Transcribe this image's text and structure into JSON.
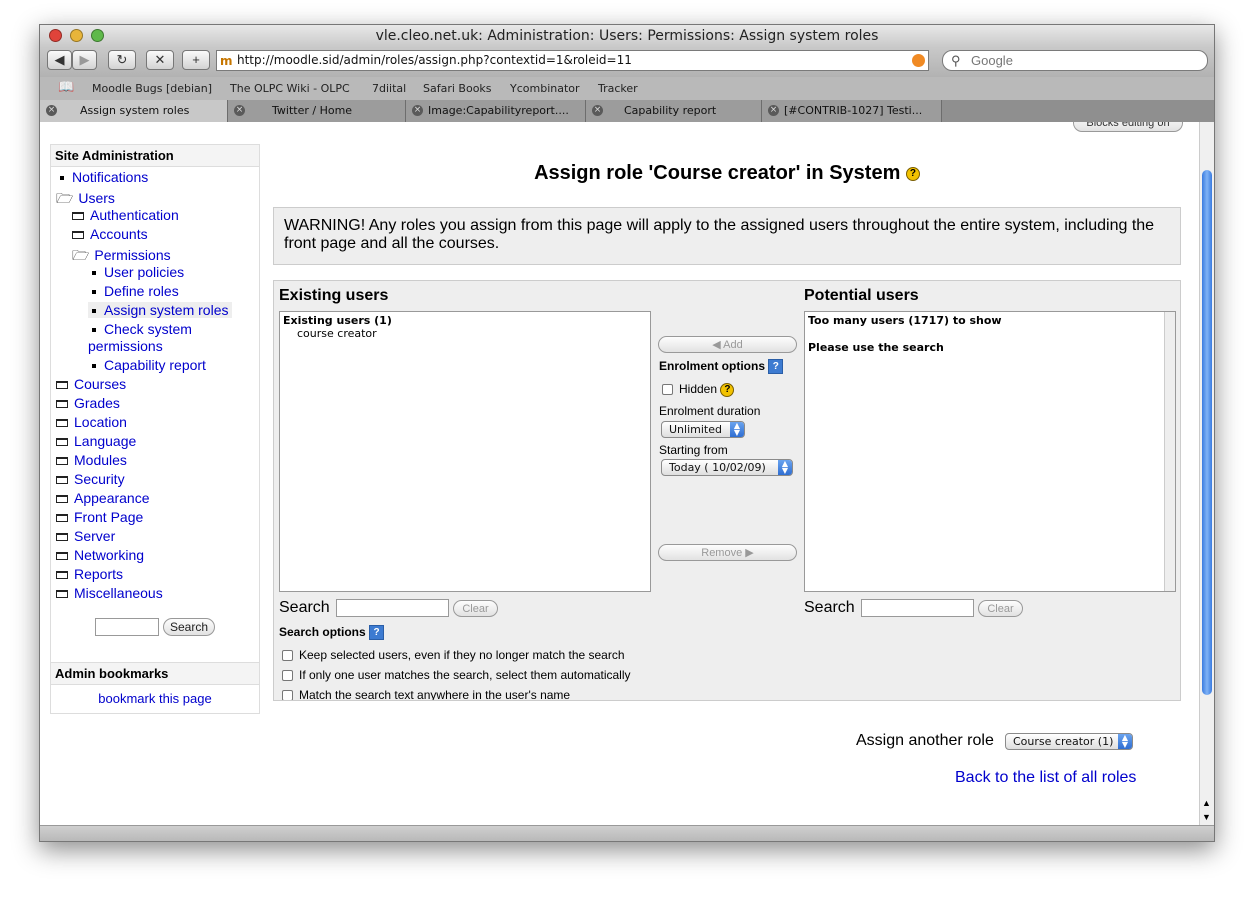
{
  "window": {
    "title": "vle.cleo.net.uk: Administration: Users: Permissions: Assign system roles",
    "url": "http://moodle.sid/admin/roles/assign.php?contextid=1&roleid=11",
    "search_placeholder": "Google"
  },
  "bookmarks": [
    "Moodle Bugs [debian]",
    "The OLPC Wiki - OLPC",
    "7diital",
    "Safari Books",
    "Ycombinator",
    "Tracker"
  ],
  "tabs": [
    {
      "label": "Assign system roles"
    },
    {
      "label": "Twitter / Home"
    },
    {
      "label": "Image:Capabilityreport...."
    },
    {
      "label": "Capability report"
    },
    {
      "label": "[#CONTRIB-1027] Testi..."
    }
  ],
  "top_partial_button": "Blocks editing on",
  "sidebar": {
    "title": "Site Administration",
    "items": {
      "notifications": "Notifications",
      "users": "Users",
      "authentication": "Authentication",
      "accounts": "Accounts",
      "permissions": "Permissions",
      "user_policies": "User policies",
      "define_roles": "Define roles",
      "assign_system_roles": "Assign system roles",
      "check_system_permissions_1": "Check system",
      "check_system_permissions_2": "permissions",
      "capability_report": "Capability report",
      "courses": "Courses",
      "grades": "Grades",
      "location": "Location",
      "language": "Language",
      "modules": "Modules",
      "security": "Security",
      "appearance": "Appearance",
      "front_page": "Front Page",
      "server": "Server",
      "networking": "Networking",
      "reports": "Reports",
      "miscellaneous": "Miscellaneous"
    },
    "search_button": "Search"
  },
  "admin_bookmarks": {
    "title": "Admin bookmarks",
    "link": "bookmark this page"
  },
  "main": {
    "heading": "Assign role 'Course creator' in System",
    "warning": "WARNING! Any roles you assign from this page will apply to the assigned users throughout the entire system, including the front page and all the courses.",
    "existing": {
      "title": "Existing users",
      "group": "Existing users (1)",
      "users": [
        "course creator"
      ],
      "search_label": "Search",
      "clear": "Clear"
    },
    "potential": {
      "title": "Potential users",
      "line1": "Too many users (1717) to show",
      "line2": "Please use the search",
      "search_label": "Search",
      "clear": "Clear"
    },
    "controls": {
      "add": "Add",
      "remove": "Remove",
      "enrolment_options": "Enrolment options",
      "hidden": "Hidden",
      "enrolment_duration": "Enrolment duration",
      "duration_value": "Unlimited",
      "starting_from": "Starting from",
      "starting_value": "Today ( 10/02/09)"
    },
    "search_options": {
      "title": "Search options",
      "opt1": "Keep selected users, even if they no longer match the search",
      "opt2": "If only one user matches the search, select them automatically",
      "opt3": "Match the search text anywhere in the user's name"
    },
    "assign_another_label": "Assign another role",
    "assign_another_value": "Course creator (1)",
    "back_link": "Back to the list of all roles"
  },
  "colors": {
    "link": "#0000cc",
    "accent": "#3d7bd1"
  }
}
